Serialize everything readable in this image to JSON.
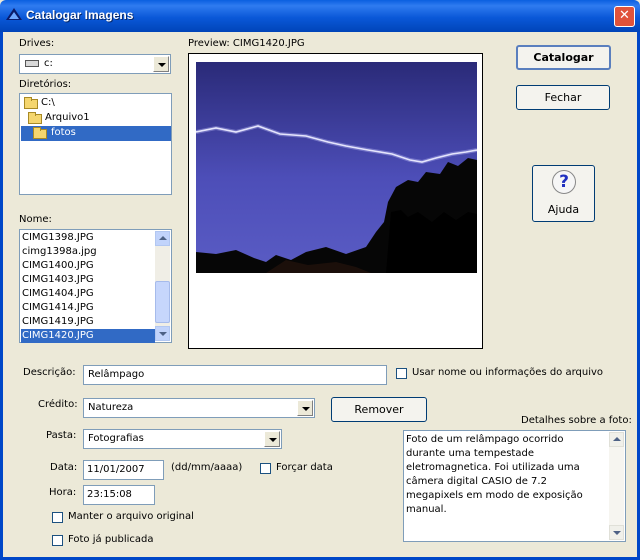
{
  "window": {
    "title": "Catalogar Imagens",
    "close_glyph": "✕"
  },
  "drives": {
    "label": "Drives:",
    "value": "c:"
  },
  "directories": {
    "label": "Diretórios:",
    "items": [
      {
        "label": "C:\\"
      },
      {
        "label": "Arquivo1"
      },
      {
        "label": "fotos"
      }
    ],
    "selected": 2
  },
  "files": {
    "label": "Nome:",
    "items": [
      "CIMG1398.JPG",
      "cimg1398a.jpg",
      "CIMG1400.JPG",
      "CIMG1403.JPG",
      "CIMG1404.JPG",
      "CIMG1414.JPG",
      "CIMG1419.JPG",
      "CIMG1420.JPG"
    ],
    "selected": 7
  },
  "preview": {
    "label": "Preview: CIMG1420.JPG"
  },
  "buttons": {
    "catalogar": "Catalogar",
    "fechar": "Fechar",
    "ajuda": "Ajuda",
    "remover": "Remover"
  },
  "descricao": {
    "label": "Descrição:",
    "value": "Relâmpago"
  },
  "usar_nome": {
    "label": "Usar nome ou informações do arquivo",
    "checked": false
  },
  "credito": {
    "label": "Crédito:",
    "value": "Natureza"
  },
  "pasta": {
    "label": "Pasta:",
    "value": "Fotografias"
  },
  "data": {
    "label": "Data:",
    "value": "11/01/2007",
    "format": "(dd/mm/aaaa)"
  },
  "forcar_data": {
    "label": "Forçar data",
    "checked": false
  },
  "hora": {
    "label": "Hora:",
    "value": "23:15:08"
  },
  "manter_original": {
    "label": "Manter o arquivo original",
    "checked": false
  },
  "foto_publicada": {
    "label": "Foto já publicada",
    "checked": false
  },
  "detalhes": {
    "label": "Detalhes sobre a foto:",
    "text": "Foto de um relâmpago ocorrido durante uma tempestade eletromagnetica. Foi utilizada uma câmera digital CASIO de 7.2 megapixels em modo de exposição manual."
  },
  "colors": {
    "titlebar": "#0a58d8",
    "selection": "#316ac5",
    "face": "#ece9d8"
  }
}
